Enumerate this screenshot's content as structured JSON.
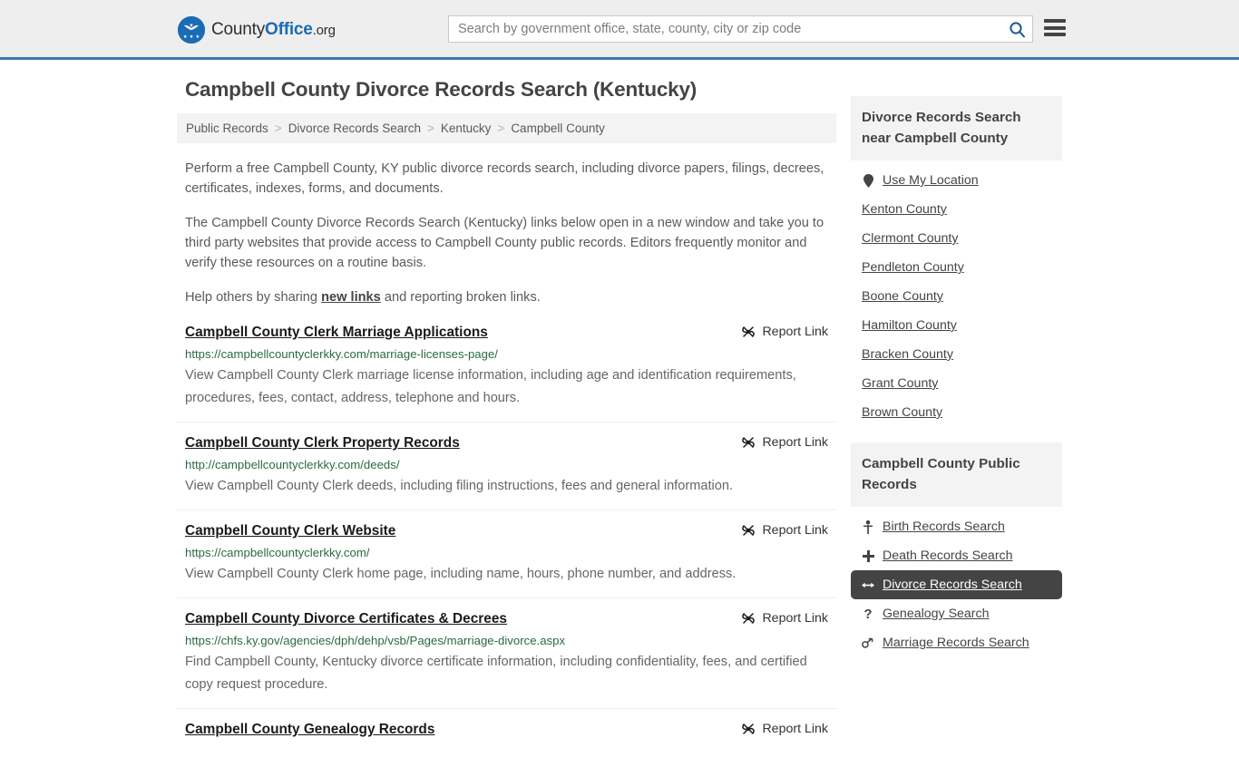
{
  "header": {
    "logo": {
      "part1": "County",
      "part2": "Office",
      "part3": ".org"
    },
    "search": {
      "placeholder": "Search by government office, state, county, city or zip code",
      "value": "",
      "icon": "search-icon"
    },
    "menu_icon": "hamburger-menu-icon"
  },
  "main": {
    "title": "Campbell County Divorce Records Search (Kentucky)",
    "breadcrumb": {
      "separator": ">",
      "items": [
        {
          "label": "Public Records"
        },
        {
          "label": "Divorce Records Search"
        },
        {
          "label": "Kentucky"
        },
        {
          "label": "Campbell County"
        }
      ]
    },
    "intro": {
      "p1": "Perform a free Campbell County, KY public divorce records search, including divorce papers, filings, decrees, certificates, indexes, forms, and documents.",
      "p2": "The Campbell County Divorce Records Search (Kentucky) links below open in a new window and take you to third party websites that provide access to Campbell County public records. Editors frequently monitor and verify these resources on a routine basis.",
      "p3_before": "Help others by sharing ",
      "p3_link": "new links",
      "p3_after": " and reporting broken links."
    },
    "report_link_label": "Report Link",
    "report_link_icon": "broken-link-icon",
    "results": [
      {
        "title": "Campbell County Clerk Marriage Applications",
        "url": "https://campbellcountyclerkky.com/marriage-licenses-page/",
        "description": "View Campbell County Clerk marriage license information, including age and identification requirements, procedures, fees, contact, address, telephone and hours."
      },
      {
        "title": "Campbell County Clerk Property Records",
        "url": "http://campbellcountyclerkky.com/deeds/",
        "description": "View Campbell County Clerk deeds, including filing instructions, fees and general information."
      },
      {
        "title": "Campbell County Clerk Website",
        "url": "https://campbellcountyclerkky.com/",
        "description": "View Campbell County Clerk home page, including name, hours, phone number, and address."
      },
      {
        "title": "Campbell County Divorce Certificates & Decrees",
        "url": "https://chfs.ky.gov/agencies/dph/dehp/vsb/Pages/marriage-divorce.aspx",
        "description": "Find Campbell County, Kentucky divorce certificate information, including confidentiality, fees, and certified copy request procedure."
      },
      {
        "title": "Campbell County Genealogy Records",
        "url": "",
        "description": ""
      }
    ]
  },
  "sidebar": {
    "nearby": {
      "title": "Divorce Records Search near Campbell County",
      "items": [
        {
          "label": "Use My Location",
          "icon": "map-pin-icon",
          "active": false
        },
        {
          "label": "Kenton County",
          "icon": "",
          "active": false
        },
        {
          "label": "Clermont County",
          "icon": "",
          "active": false
        },
        {
          "label": "Pendleton County",
          "icon": "",
          "active": false
        },
        {
          "label": "Boone County",
          "icon": "",
          "active": false
        },
        {
          "label": "Hamilton County",
          "icon": "",
          "active": false
        },
        {
          "label": "Bracken County",
          "icon": "",
          "active": false
        },
        {
          "label": "Grant County",
          "icon": "",
          "active": false
        },
        {
          "label": "Brown County",
          "icon": "",
          "active": false
        }
      ]
    },
    "public_records": {
      "title": "Campbell County Public Records",
      "items": [
        {
          "label": "Birth Records Search",
          "icon": "infant-icon",
          "glyph": "\u0001",
          "active": false
        },
        {
          "label": "Death Records Search",
          "icon": "cross-icon",
          "glyph": "✚",
          "active": false
        },
        {
          "label": "Divorce Records Search",
          "icon": "left-right-arrow-icon",
          "glyph": "↔",
          "active": true
        },
        {
          "label": "Genealogy Search",
          "icon": "question-mark-icon",
          "glyph": "?",
          "active": false
        },
        {
          "label": "Marriage Records Search",
          "icon": "male-female-icon",
          "glyph": "⚥",
          "active": false
        }
      ]
    }
  },
  "colors": {
    "accent_blue": "#1b6cb5",
    "header_border": "#3a7ab0",
    "url_green": "#2a6b3f",
    "active_bg": "#444444",
    "panel_bg": "#f3f3f3"
  }
}
